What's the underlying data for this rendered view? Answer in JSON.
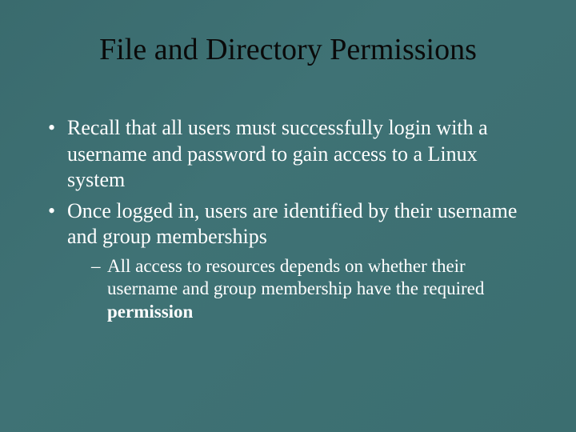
{
  "title": "File and Directory Permissions",
  "bullets": [
    "Recall that all users must successfully login with a username and password to gain access to a Linux system",
    "Once logged in, users are identified by their username and group memberships"
  ],
  "sub_prefix": "All access to resources depends on whether their username and group membership have the required ",
  "sub_bold": "permission"
}
